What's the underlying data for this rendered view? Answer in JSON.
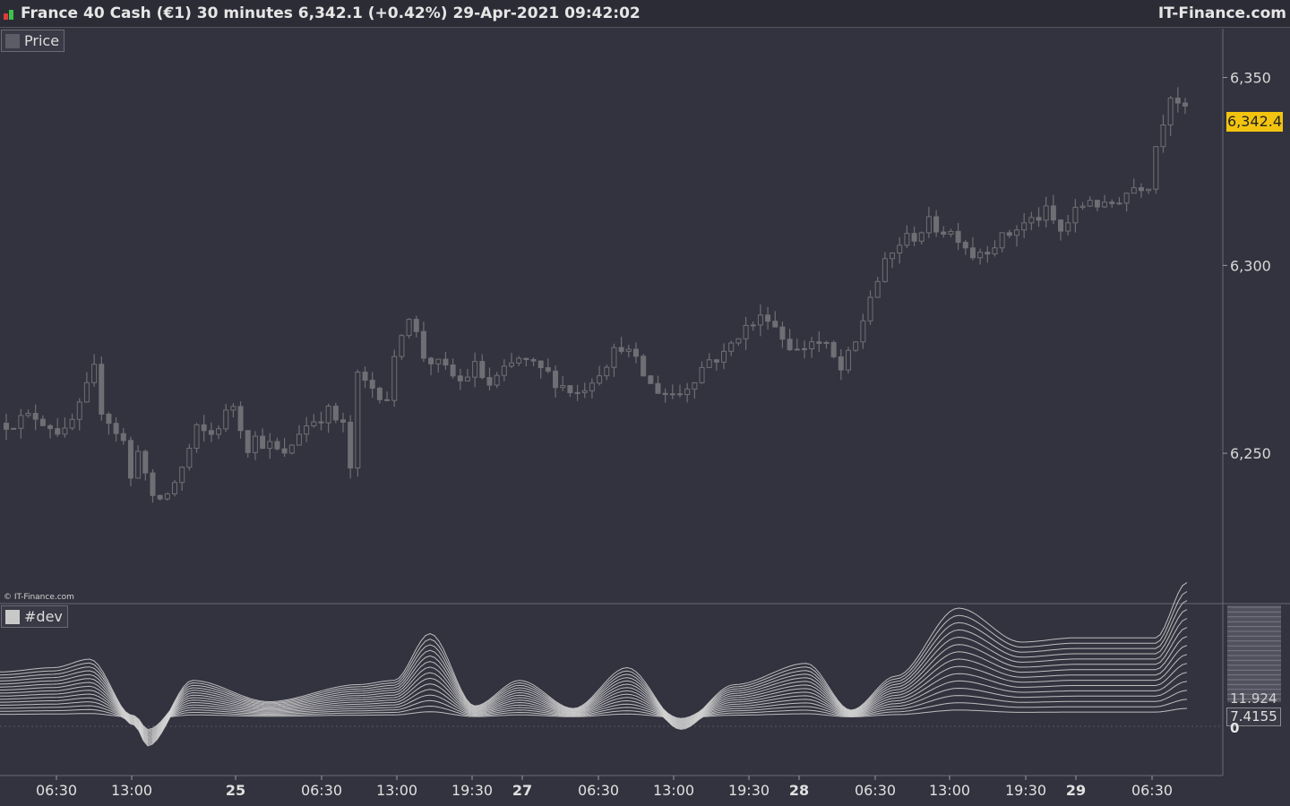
{
  "header": {
    "title": "France 40 Cash (€1) 30 minutes 6,342.1 (+0.42%) 29-Apr-2021 09:42:02",
    "brand": "IT-Finance.com",
    "icon_colors": [
      "#e03a3a",
      "#3ac24a"
    ]
  },
  "price_panel": {
    "legend": "Price",
    "legend_color": "#5c5c66",
    "copyright": "© IT-Finance.com",
    "current_price": "6,342.4",
    "current_price_color": "#f2c40f"
  },
  "dev_panel": {
    "legend": "#dev",
    "legend_color": "#c8c8c8",
    "value_1": "11.924",
    "value_2": "7.4155",
    "zero_label": "0"
  },
  "chart_data": [
    {
      "type": "candlestick",
      "name": "Price",
      "ylim": [
        6210,
        6363
      ],
      "y_ticks": [
        6250,
        6300,
        6350
      ],
      "y_tick_labels": [
        "6,250",
        "6,300",
        "6,350"
      ],
      "x_tick_labels": [
        "06:30",
        "13:00",
        "25",
        "06:30",
        "13:00",
        "19:30",
        "27",
        "06:30",
        "13:00",
        "19:30",
        "28",
        "06:30",
        "13:00",
        "19:30",
        "29",
        "06:30"
      ],
      "close_path": [
        [
          0,
          6258
        ],
        [
          4,
          6260
        ],
        [
          8,
          6255
        ],
        [
          10,
          6262
        ],
        [
          12,
          6272
        ],
        [
          13,
          6262
        ],
        [
          16,
          6253
        ],
        [
          17,
          6243
        ],
        [
          18,
          6252
        ],
        [
          20,
          6237
        ],
        [
          22,
          6239
        ],
        [
          24,
          6246
        ],
        [
          26,
          6256
        ],
        [
          28,
          6255
        ],
        [
          31,
          6263
        ],
        [
          33,
          6252
        ],
        [
          34,
          6254
        ],
        [
          36,
          6252
        ],
        [
          38,
          6249
        ],
        [
          40,
          6256
        ],
        [
          42,
          6259
        ],
        [
          44,
          6261
        ],
        [
          46,
          6257
        ],
        [
          47,
          6246
        ],
        [
          48,
          6270
        ],
        [
          52,
          6265
        ],
        [
          54,
          6283
        ],
        [
          55,
          6287
        ],
        [
          57,
          6276
        ],
        [
          60,
          6272
        ],
        [
          62,
          6269
        ],
        [
          64,
          6273
        ],
        [
          66,
          6268
        ],
        [
          70,
          6275
        ],
        [
          72,
          6273
        ],
        [
          74,
          6271
        ],
        [
          76,
          6268
        ],
        [
          78,
          6266
        ],
        [
          80,
          6270
        ],
        [
          84,
          6279
        ],
        [
          86,
          6274
        ],
        [
          88,
          6268
        ],
        [
          90,
          6266
        ],
        [
          92,
          6266
        ],
        [
          96,
          6275
        ],
        [
          98,
          6276
        ],
        [
          100,
          6282
        ],
        [
          104,
          6287
        ],
        [
          106,
          6281
        ],
        [
          108,
          6277
        ],
        [
          110,
          6280
        ],
        [
          112,
          6278
        ],
        [
          114,
          6272
        ],
        [
          116,
          6279
        ],
        [
          118,
          6292
        ],
        [
          120,
          6300
        ],
        [
          122,
          6306
        ],
        [
          124,
          6308
        ],
        [
          126,
          6311
        ],
        [
          130,
          6308
        ],
        [
          132,
          6303
        ],
        [
          134,
          6305
        ],
        [
          136,
          6307
        ],
        [
          138,
          6310
        ],
        [
          140,
          6312
        ],
        [
          142,
          6314
        ],
        [
          144,
          6309
        ],
        [
          146,
          6314
        ],
        [
          148,
          6318
        ],
        [
          150,
          6315
        ],
        [
          152,
          6318
        ],
        [
          154,
          6321
        ],
        [
          156,
          6322
        ],
        [
          157,
          6332
        ],
        [
          158,
          6339
        ],
        [
          159,
          6346
        ],
        [
          160,
          6344
        ],
        [
          161,
          6342.4
        ]
      ],
      "candle_count": 162
    },
    {
      "type": "line",
      "name": "#dev",
      "series_count": 15,
      "zero_line": 0,
      "value_labels": [
        "11.924",
        "7.4155",
        "0"
      ]
    }
  ]
}
